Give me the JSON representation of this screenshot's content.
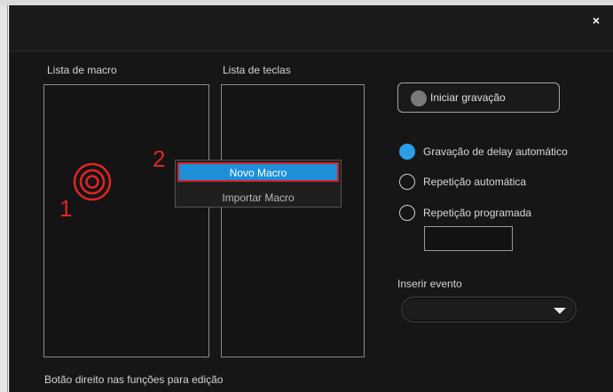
{
  "window": {
    "close_label": "×"
  },
  "macro_list": {
    "label": "Lista de macro"
  },
  "key_list": {
    "label": "Lista de teclas"
  },
  "annotations": {
    "step1": "1",
    "step2": "2"
  },
  "context_menu": {
    "items": [
      "Novo Macro",
      "Importar Macro"
    ],
    "highlighted_index": 0
  },
  "record_button": {
    "label": "Iniciar gravação"
  },
  "radios": [
    {
      "label": "Gravação de delay automático",
      "selected": true
    },
    {
      "label": "Repetição automática",
      "selected": false
    },
    {
      "label": "Repetição programada",
      "selected": false
    }
  ],
  "repeat_input": {
    "value": ""
  },
  "insert_event": {
    "label": "Inserir evento",
    "value": ""
  },
  "footer": {
    "hint": "Botão direito nas funções para edição"
  },
  "colors": {
    "accent": "#2a9fe8",
    "highlight": "#1e8fd8",
    "annotation": "#e02424",
    "background": "#161616"
  },
  "icons": {
    "target": "concentric-circles-target",
    "close": "close-x",
    "dropdown": "triangle-down",
    "record": "record-dot"
  }
}
